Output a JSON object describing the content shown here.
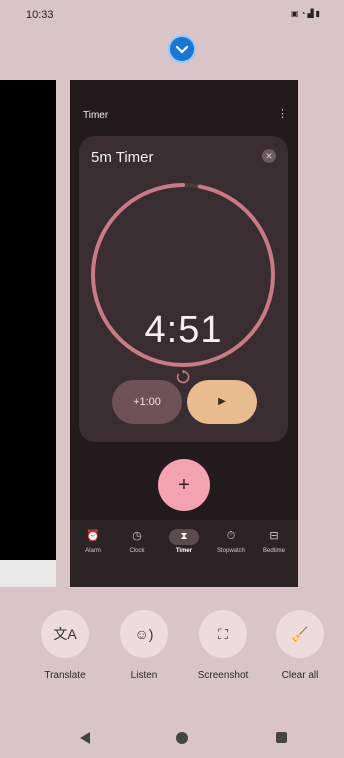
{
  "status_bar": {
    "time": "10:33",
    "icons": [
      "sim-icon",
      "wifi-icon",
      "signal-icon",
      "battery-icon"
    ]
  },
  "app": {
    "icon": "clock-app-icon"
  },
  "clock_app": {
    "title": "Timer",
    "menu_icon": "more-vert-icon",
    "timer": {
      "label": "5m Timer",
      "remaining": "4:51",
      "progress": 0.97,
      "add_label": "+1:00",
      "play_label": "▶",
      "reset_icon": "reset-icon",
      "close_icon": "close-icon"
    },
    "fab_label": "+",
    "tabs": [
      {
        "icon": "alarm-icon",
        "label": "Alarm"
      },
      {
        "icon": "clock-icon",
        "label": "Clock"
      },
      {
        "icon": "hourglass-icon",
        "label": "Timer",
        "active": true
      },
      {
        "icon": "stopwatch-icon",
        "label": "Stopwatch"
      },
      {
        "icon": "bedtime-icon",
        "label": "Bedtime"
      }
    ],
    "colors": {
      "ring": "#c77b86",
      "panel": "#3a2d31",
      "fab": "#f3a4b0",
      "play": "#e8bc8e"
    }
  },
  "recents_actions": [
    {
      "icon": "translate-icon",
      "label": "Translate"
    },
    {
      "icon": "listen-icon",
      "label": "Listen"
    },
    {
      "icon": "screenshot-icon",
      "label": "Screenshot"
    },
    {
      "icon": "clear-all-icon",
      "label": "Clear all"
    }
  ]
}
